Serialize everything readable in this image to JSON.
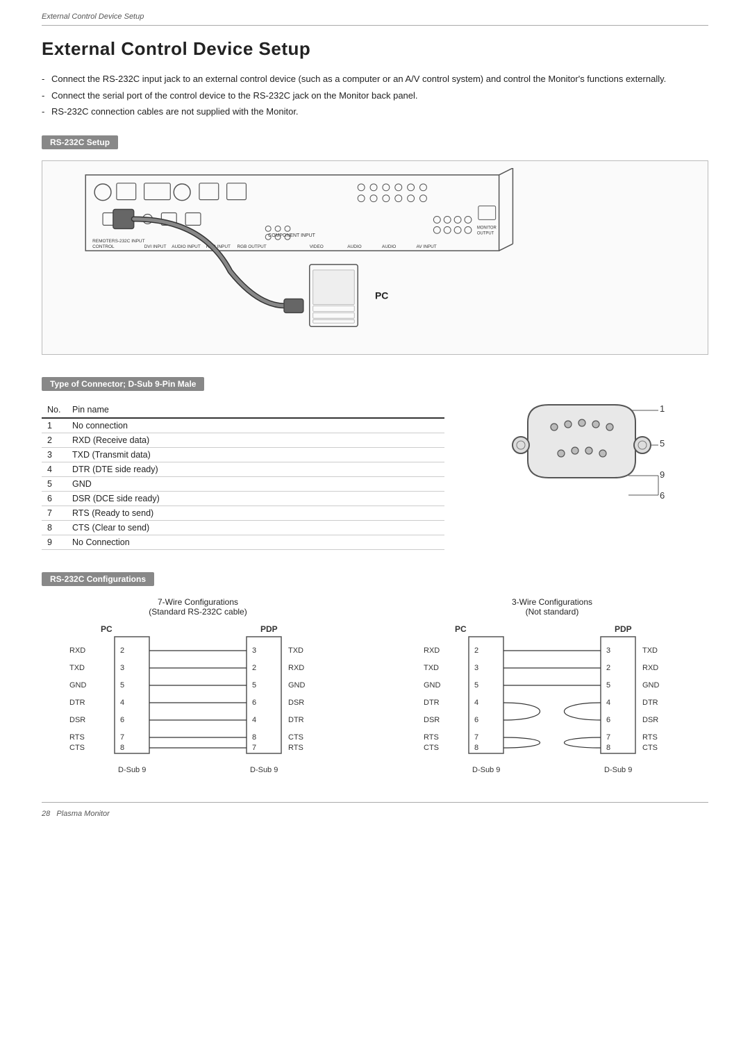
{
  "header": {
    "text": "External Control Device Setup"
  },
  "page_title": "External Control Device Setup",
  "intro_bullets": [
    "Connect the RS-232C input jack to an external control device (such as a computer or an A/V control system) and control the Monitor's functions externally.",
    "Connect the serial port of the control device to the RS-232C jack on the Monitor back panel.",
    "RS-232C connection cables are not supplied with the Monitor."
  ],
  "section_rs232c_setup": "RS-232C Setup",
  "section_connector": "Type of Connector; D-Sub 9-Pin Male",
  "connector_table": {
    "headers": [
      "No.",
      "Pin name"
    ],
    "rows": [
      [
        "1",
        "No connection"
      ],
      [
        "2",
        "RXD (Receive data)"
      ],
      [
        "3",
        "TXD (Transmit data)"
      ],
      [
        "4",
        "DTR (DTE side ready)"
      ],
      [
        "5",
        "GND"
      ],
      [
        "6",
        "DSR (DCE side ready)"
      ],
      [
        "7",
        "RTS (Ready to send)"
      ],
      [
        "8",
        "CTS (Clear to send)"
      ],
      [
        "9",
        "No Connection"
      ]
    ]
  },
  "section_rs232c_config": "RS-232C Configurations",
  "wire7_title": "7-Wire Configurations",
  "wire7_subtitle": "(Standard RS-232C cable)",
  "wire3_title": "3-Wire Configurations",
  "wire3_subtitle": "(Not standard)",
  "wire7": {
    "pc_col": "PC",
    "pdp_col": "PDP",
    "pc_pins": [
      {
        "label": "RXD",
        "num": "2"
      },
      {
        "label": "TXD",
        "num": "3"
      },
      {
        "label": "GND",
        "num": "5"
      },
      {
        "label": "DTR",
        "num": "4"
      },
      {
        "label": "DSR",
        "num": "6"
      },
      {
        "label": "RTS",
        "num": "7"
      },
      {
        "label": "CTS",
        "num": "8"
      }
    ],
    "pdp_pins": [
      {
        "num": "3",
        "label": "TXD"
      },
      {
        "num": "2",
        "label": "RXD"
      },
      {
        "num": "5",
        "label": "GND"
      },
      {
        "num": "6",
        "label": "DSR"
      },
      {
        "num": "4",
        "label": "DTR"
      },
      {
        "num": "8",
        "label": "CTS"
      },
      {
        "num": "7",
        "label": "RTS"
      }
    ],
    "dsub_left": "D-Sub 9",
    "dsub_right": "D-Sub 9"
  },
  "wire3": {
    "pc_col": "PC",
    "pdp_col": "PDP",
    "pc_pins": [
      {
        "label": "RXD",
        "num": "2"
      },
      {
        "label": "TXD",
        "num": "3"
      },
      {
        "label": "GND",
        "num": "5"
      },
      {
        "label": "DTR",
        "num": "4"
      },
      {
        "label": "DSR",
        "num": "6"
      },
      {
        "label": "RTS",
        "num": "7"
      },
      {
        "label": "CTS",
        "num": "8"
      }
    ],
    "pdp_pins": [
      {
        "num": "3",
        "label": "TXD"
      },
      {
        "num": "2",
        "label": "RXD"
      },
      {
        "num": "5",
        "label": "GND"
      },
      {
        "num": "4",
        "label": "DTR"
      },
      {
        "num": "6",
        "label": "DSR"
      },
      {
        "num": "7",
        "label": "RTS"
      },
      {
        "num": "8",
        "label": "CTS"
      }
    ],
    "dsub_left": "D-Sub 9",
    "dsub_right": "D-Sub 9"
  },
  "pc_label": "PC",
  "footer": {
    "page_num": "28",
    "product": "Plasma Monitor"
  }
}
